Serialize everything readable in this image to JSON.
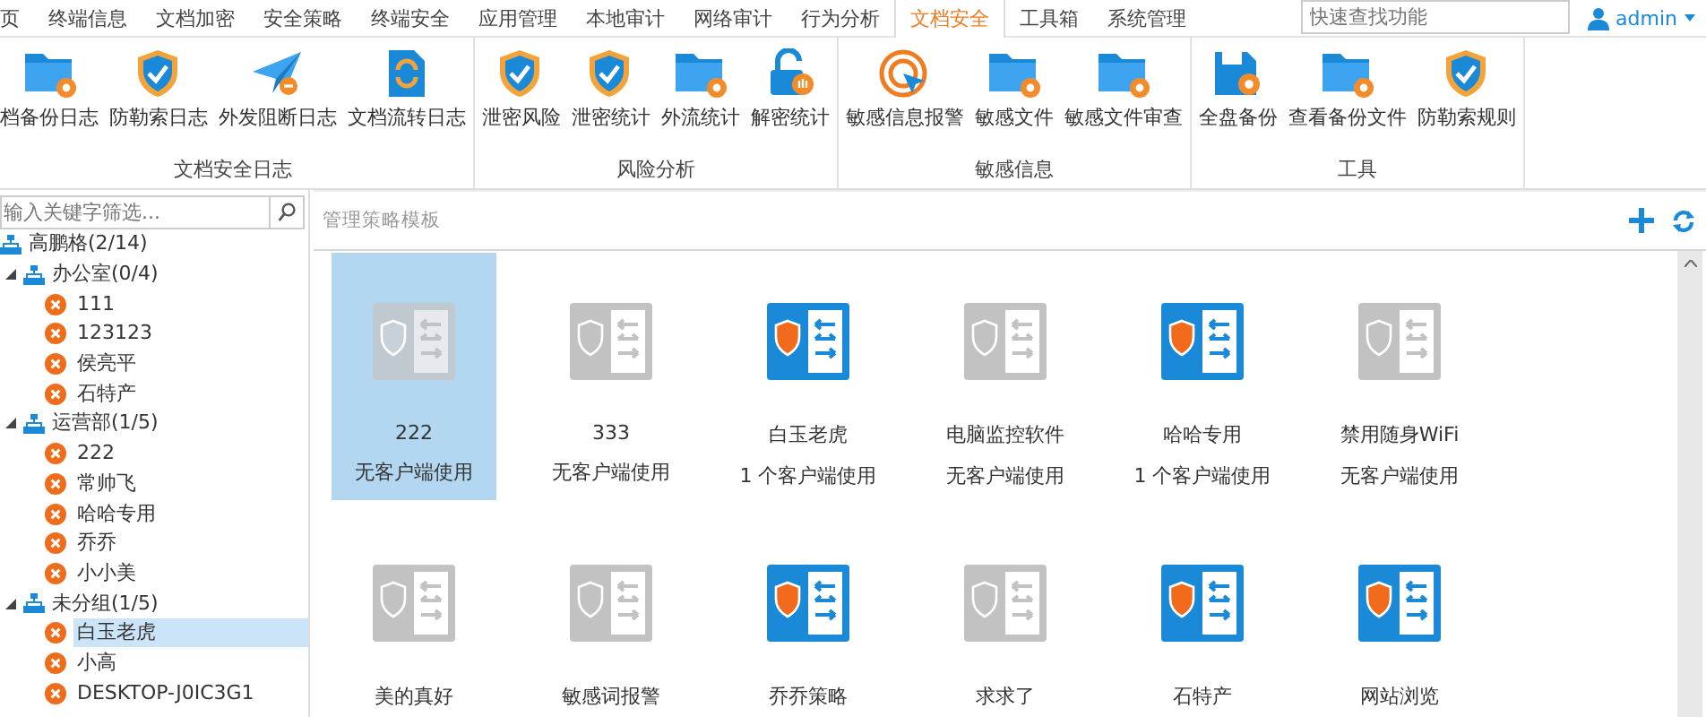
{
  "menu_tabs": [
    {
      "label": "页",
      "selected": false
    },
    {
      "label": "终端信息",
      "selected": false
    },
    {
      "label": "文档加密",
      "selected": false
    },
    {
      "label": "安全策略",
      "selected": false
    },
    {
      "label": "终端安全",
      "selected": false
    },
    {
      "label": "应用管理",
      "selected": false
    },
    {
      "label": "本地审计",
      "selected": false
    },
    {
      "label": "网络审计",
      "selected": false
    },
    {
      "label": "行为分析",
      "selected": false
    },
    {
      "label": "文档安全",
      "selected": true
    },
    {
      "label": "工具箱",
      "selected": false
    },
    {
      "label": "系统管理",
      "selected": false
    }
  ],
  "search": {
    "placeholder": "快速查找功能"
  },
  "user": {
    "name": "admin"
  },
  "ribbon_groups": [
    {
      "title": "文档安全日志",
      "buttons": [
        {
          "label": "档备份日志",
          "kind": "folder"
        },
        {
          "label": "防勒索日志",
          "kind": "shield"
        },
        {
          "label": "外发阻断日志",
          "kind": "plane"
        },
        {
          "label": "文档流转日志",
          "kind": "document"
        }
      ]
    },
    {
      "title": "风险分析",
      "buttons": [
        {
          "label": "泄密风险",
          "kind": "shield"
        },
        {
          "label": "泄密统计",
          "kind": "shield"
        },
        {
          "label": "外流统计",
          "kind": "folder"
        },
        {
          "label": "解密统计",
          "kind": "lock"
        }
      ]
    },
    {
      "title": "敏感信息",
      "buttons": [
        {
          "label": "敏感信息报警",
          "kind": "target"
        },
        {
          "label": "敏感文件",
          "kind": "folder"
        },
        {
          "label": "敏感文件审查",
          "kind": "folder"
        }
      ]
    },
    {
      "title": "工具",
      "buttons": [
        {
          "label": "全盘备份",
          "kind": "disk"
        },
        {
          "label": "查看备份文件",
          "kind": "folder"
        },
        {
          "label": "防勒索规则",
          "kind": "shield"
        }
      ]
    }
  ],
  "tree_filter": {
    "placeholder": "输入关键字筛选..."
  },
  "tree": {
    "label": "高鹏格(2/14)",
    "children": [
      {
        "label": "办公室(0/4)",
        "expanded": true,
        "children": [
          {
            "label": "111",
            "selected": false
          },
          {
            "label": "123123",
            "selected": false
          },
          {
            "label": "侯亮平",
            "selected": false
          },
          {
            "label": "石特产",
            "selected": false
          }
        ]
      },
      {
        "label": "运营部(1/5)",
        "expanded": true,
        "children": [
          {
            "label": "222",
            "selected": false
          },
          {
            "label": "常帅飞",
            "selected": false
          },
          {
            "label": "哈哈专用",
            "selected": false
          },
          {
            "label": "乔乔",
            "selected": false
          },
          {
            "label": "小小美",
            "selected": false
          }
        ]
      },
      {
        "label": "未分组(1/5)",
        "expanded": true,
        "children": [
          {
            "label": "白玉老虎",
            "selected": true
          },
          {
            "label": "小高",
            "selected": false
          },
          {
            "label": "DESKTOP-J0IC3G1",
            "selected": false
          }
        ]
      }
    ]
  },
  "panel": {
    "title": "管理策略模板"
  },
  "templates": [
    {
      "name": "222",
      "usage": "无客户端使用",
      "enabled": false,
      "selected": true
    },
    {
      "name": "333",
      "usage": "无客户端使用",
      "enabled": false,
      "selected": false
    },
    {
      "name": "白玉老虎",
      "usage": "1 个客户端使用",
      "enabled": true,
      "selected": false
    },
    {
      "name": "电脑监控软件",
      "usage": "无客户端使用",
      "enabled": false,
      "selected": false
    },
    {
      "name": "哈哈专用",
      "usage": "1 个客户端使用",
      "enabled": true,
      "selected": false
    },
    {
      "name": "禁用随身WiFi",
      "usage": "无客户端使用",
      "enabled": false,
      "selected": false
    },
    {
      "name": "美的真好",
      "enabled": false,
      "selected": false
    },
    {
      "name": "敏感词报警",
      "enabled": false,
      "selected": false
    },
    {
      "name": "乔乔策略",
      "enabled": true,
      "selected": false
    },
    {
      "name": "求求了",
      "enabled": false,
      "selected": false
    },
    {
      "name": "石特产",
      "enabled": true,
      "selected": false
    },
    {
      "name": "网站浏览",
      "enabled": true,
      "selected": false
    }
  ]
}
